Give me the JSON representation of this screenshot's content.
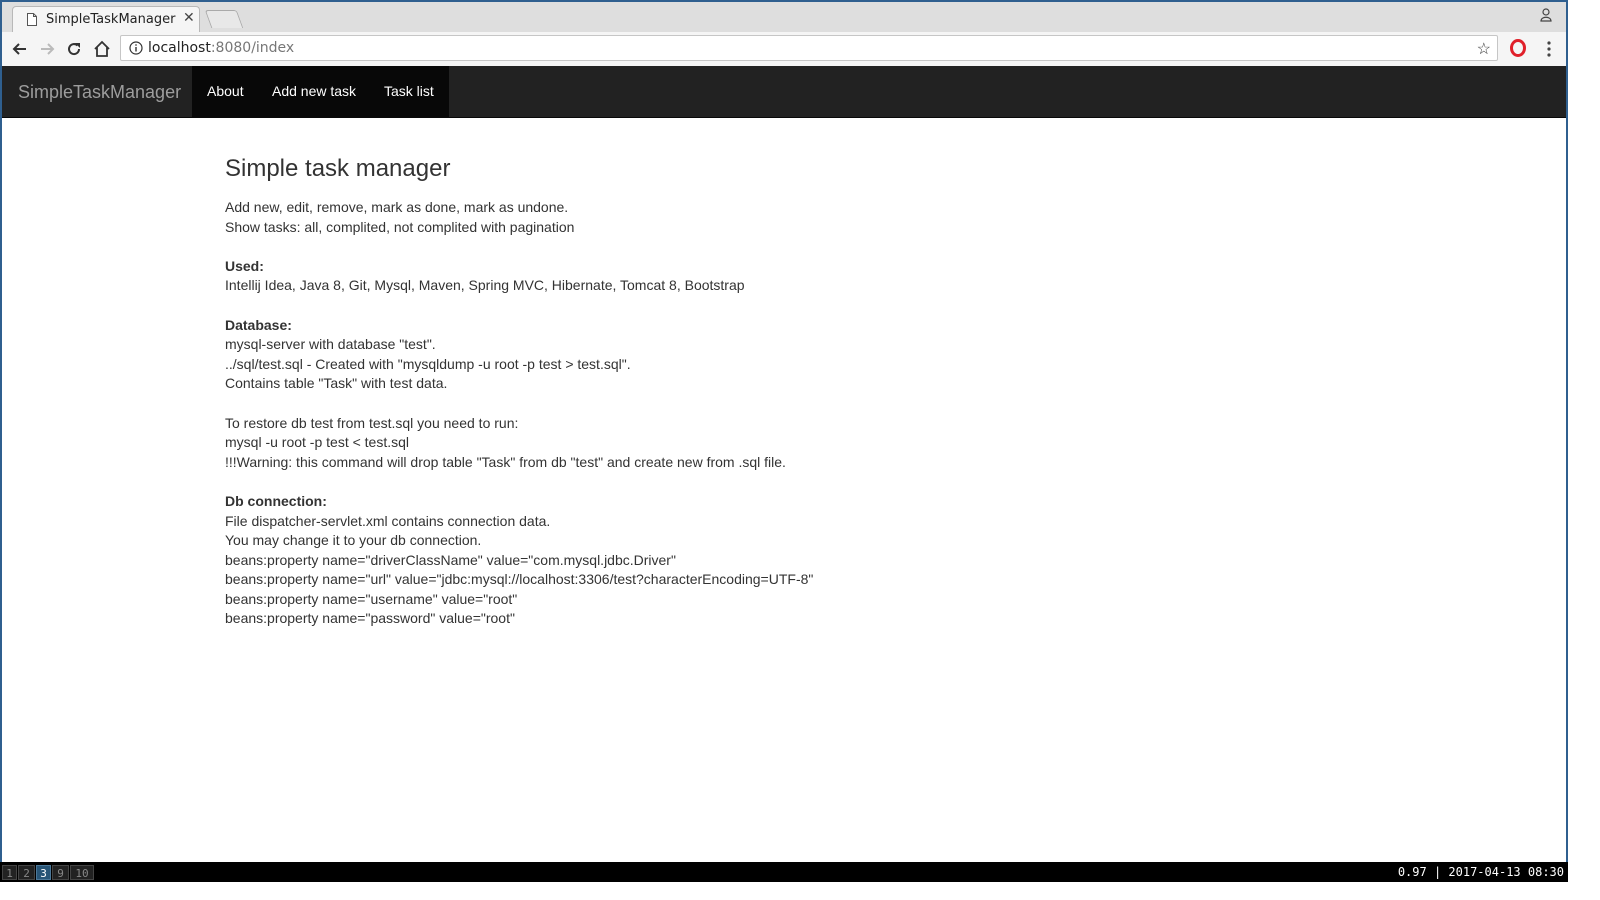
{
  "browser": {
    "tab_title": "SimpleTaskManager",
    "url_host": "localhost",
    "url_rest": ":8080/index"
  },
  "navbar": {
    "brand": "SimpleTaskManager",
    "items": [
      {
        "label": "About"
      },
      {
        "label": "Add new task"
      },
      {
        "label": "Task list"
      }
    ]
  },
  "content": {
    "title": "Simple task manager",
    "intro": [
      "Add new, edit, remove, mark as done, mark as undone.",
      "Show tasks: all, complited, not complited with pagination"
    ],
    "used_heading": "Used:",
    "used_text": "Intellij Idea, Java 8, Git, Mysql, Maven, Spring MVC, Hibernate, Tomcat 8, Bootstrap",
    "database_heading": "Database:",
    "database_lines": [
      "mysql-server with database \"test\".",
      "../sql/test.sql - Created with \"mysqldump -u root -p test > test.sql\".",
      "Contains table \"Task\" with test data."
    ],
    "restore_lines": [
      "To restore db test from test.sql you need to run:",
      "mysql -u root -p test < test.sql",
      "!!!Warning: this command will drop table \"Task\" from db \"test\" and create new from .sql file."
    ],
    "db_heading": "Db connection:",
    "db_lines": [
      "File dispatcher-servlet.xml contains connection data.",
      "You may change it to your db connection.",
      "beans:property name=\"driverClassName\" value=\"com.mysql.jdbc.Driver\"",
      "beans:property name=\"url\" value=\"jdbc:mysql://localhost:3306/test?characterEncoding=UTF-8\"",
      "beans:property name=\"username\" value=\"root\"",
      "beans:property name=\"password\" value=\"root\""
    ]
  },
  "taskbar": {
    "workspaces": [
      "1",
      "2",
      "3",
      "9",
      "10"
    ],
    "active_workspace": "3",
    "status": "0.97 | 2017-04-13 08:30"
  },
  "colors": {
    "navbar_bg": "#222222",
    "nav_active_bg": "#080808",
    "brand": "#9d9d9d",
    "workspace_active": "#285577"
  }
}
